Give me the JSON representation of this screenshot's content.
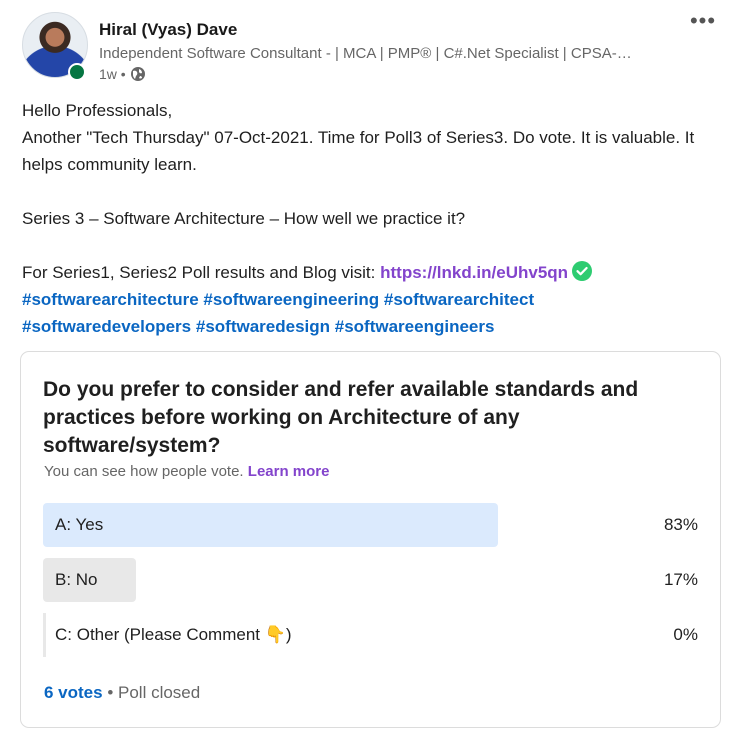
{
  "author": {
    "name": "Hiral (Vyas) Dave",
    "headline": "Independent Software Consultant - | MCA | PMP® | C#.Net Specialist | CPSA-…",
    "time": "1w •",
    "visibility_icon": "globe-icon",
    "online_color": "#057642"
  },
  "post": {
    "line1": "Hello Professionals,",
    "line2": "Another \"Tech Thursday\" 07-Oct-2021. Time for Poll3 of Series3. Do vote. It is valuable. It helps community learn.",
    "line3": "Series 3 – Software Architecture – How well we practice it?",
    "line4_prefix": "For Series1, Series2 Poll results and Blog visit: ",
    "link": "https://lnkd.in/eUhv5qn",
    "link_icon": "check-circle-icon",
    "hashtags_line1": [
      "#softwarearchitecture",
      "#softwareengineering",
      "#softwarearchitect"
    ],
    "hashtags_line2": [
      "#softwaredevelopers",
      "#softwaredesign",
      "#softwareengineers"
    ]
  },
  "poll": {
    "question": "Do you prefer to consider and refer available standards and practices before working on Architecture of any software/system?",
    "visibility_text": "You can see how people vote.",
    "learn_more": "Learn more",
    "options": [
      {
        "label": "A: Yes",
        "percent": "83%",
        "share": 0.83,
        "leading": true
      },
      {
        "label": "B: No",
        "percent": "17%",
        "share": 0.17,
        "leading": false
      },
      {
        "label": "C: Other (Please Comment 👇)",
        "percent": "0%",
        "share": 0.0,
        "leading": false
      }
    ],
    "votes": "6 votes",
    "status": "• Poll closed"
  },
  "colors": {
    "leading_bar": "#dbeafd",
    "other_bar": "#e8e8e8",
    "link": "#8344cc",
    "hashtag": "#0a66c2"
  }
}
